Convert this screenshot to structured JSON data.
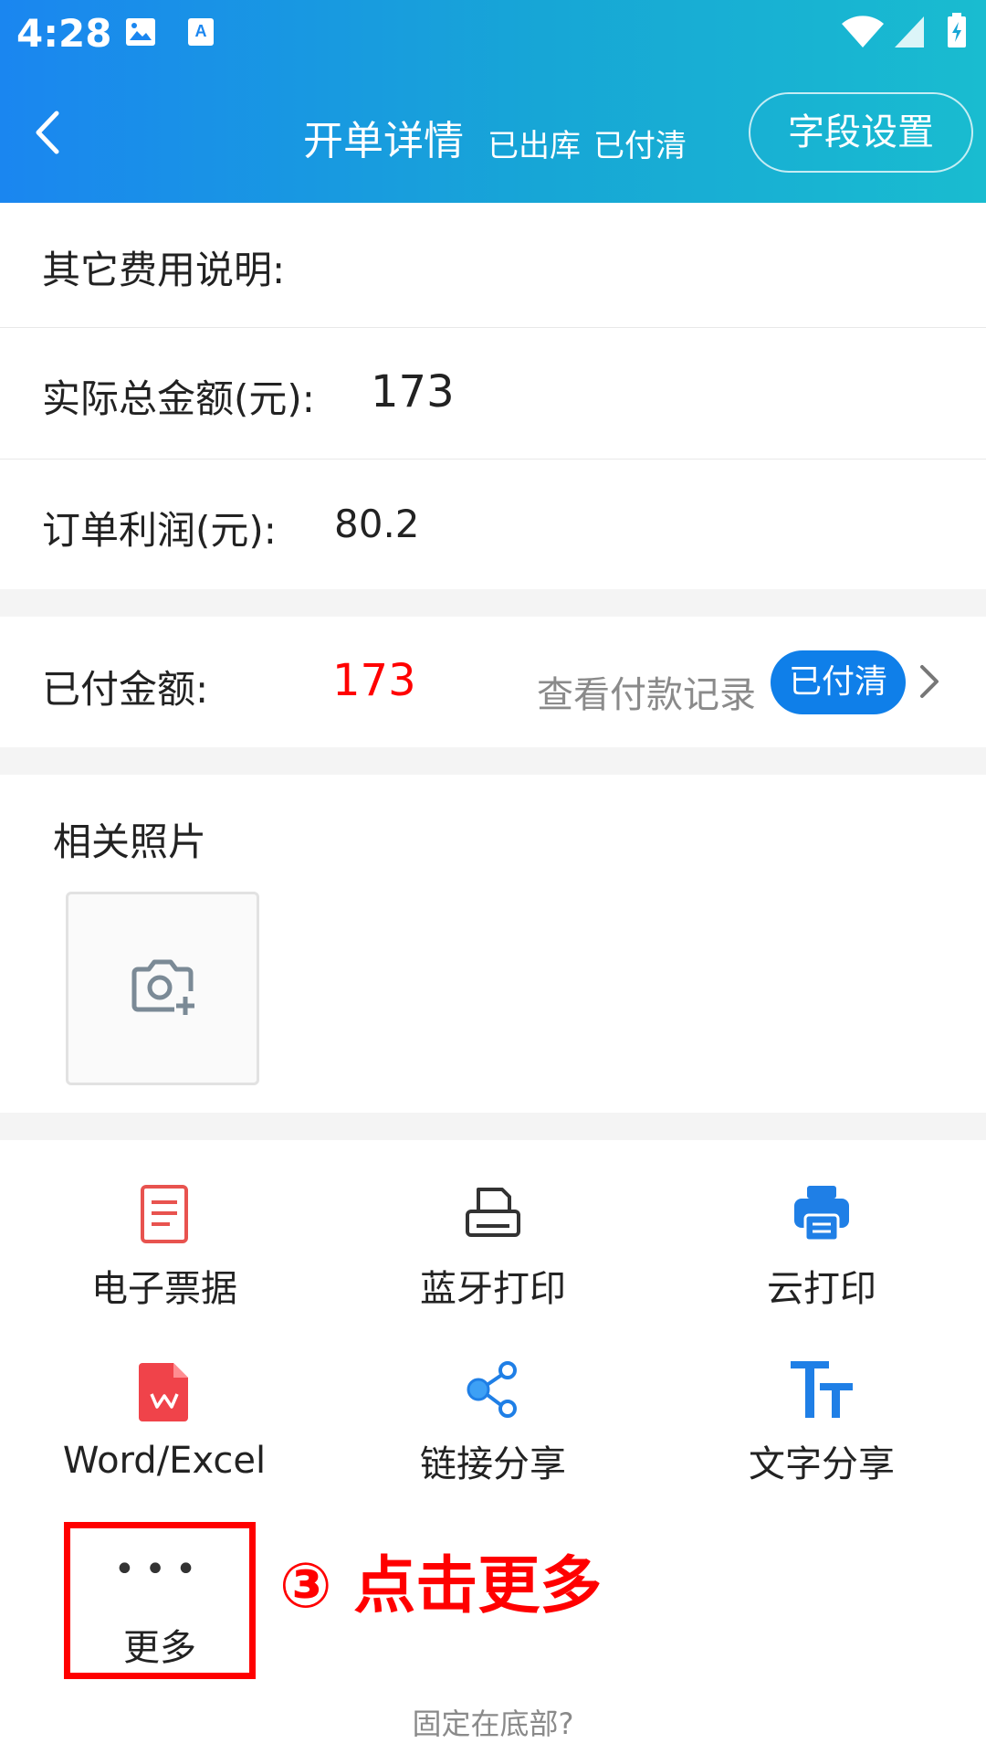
{
  "status_bar": {
    "time": "4:28"
  },
  "header": {
    "title": "开单详情",
    "status_stock": "已出库",
    "status_pay": "已付清",
    "field_settings": "字段设置"
  },
  "rows": {
    "other_fee": {
      "label": "其它费用说明:",
      "value": ""
    },
    "total": {
      "label": "实际总金额(元):",
      "value": "173"
    },
    "profit": {
      "label": "订单利润(元):",
      "value": "80.2"
    },
    "paid": {
      "label": "已付金额:",
      "value": "173",
      "view_records": "查看付款记录",
      "badge": "已付清"
    }
  },
  "photos": {
    "title": "相关照片"
  },
  "actions": [
    {
      "label": "电子票据",
      "icon": "document-icon"
    },
    {
      "label": "蓝牙打印",
      "icon": "printer-outline-icon"
    },
    {
      "label": "云打印",
      "icon": "printer-filled-icon"
    },
    {
      "label": "Word/Excel",
      "icon": "wps-file-icon"
    },
    {
      "label": "链接分享",
      "icon": "share-icon"
    },
    {
      "label": "文字分享",
      "icon": "text-tt-icon"
    }
  ],
  "more": {
    "dots": "•••",
    "label": "更多"
  },
  "annotation": "③ 点击更多",
  "footer": {
    "pin_bottom": "固定在底部?"
  },
  "colors": {
    "accent": "#0f7fe9",
    "red": "#ff0000",
    "header_start": "#1a86f0",
    "header_end": "#19bcd0"
  }
}
